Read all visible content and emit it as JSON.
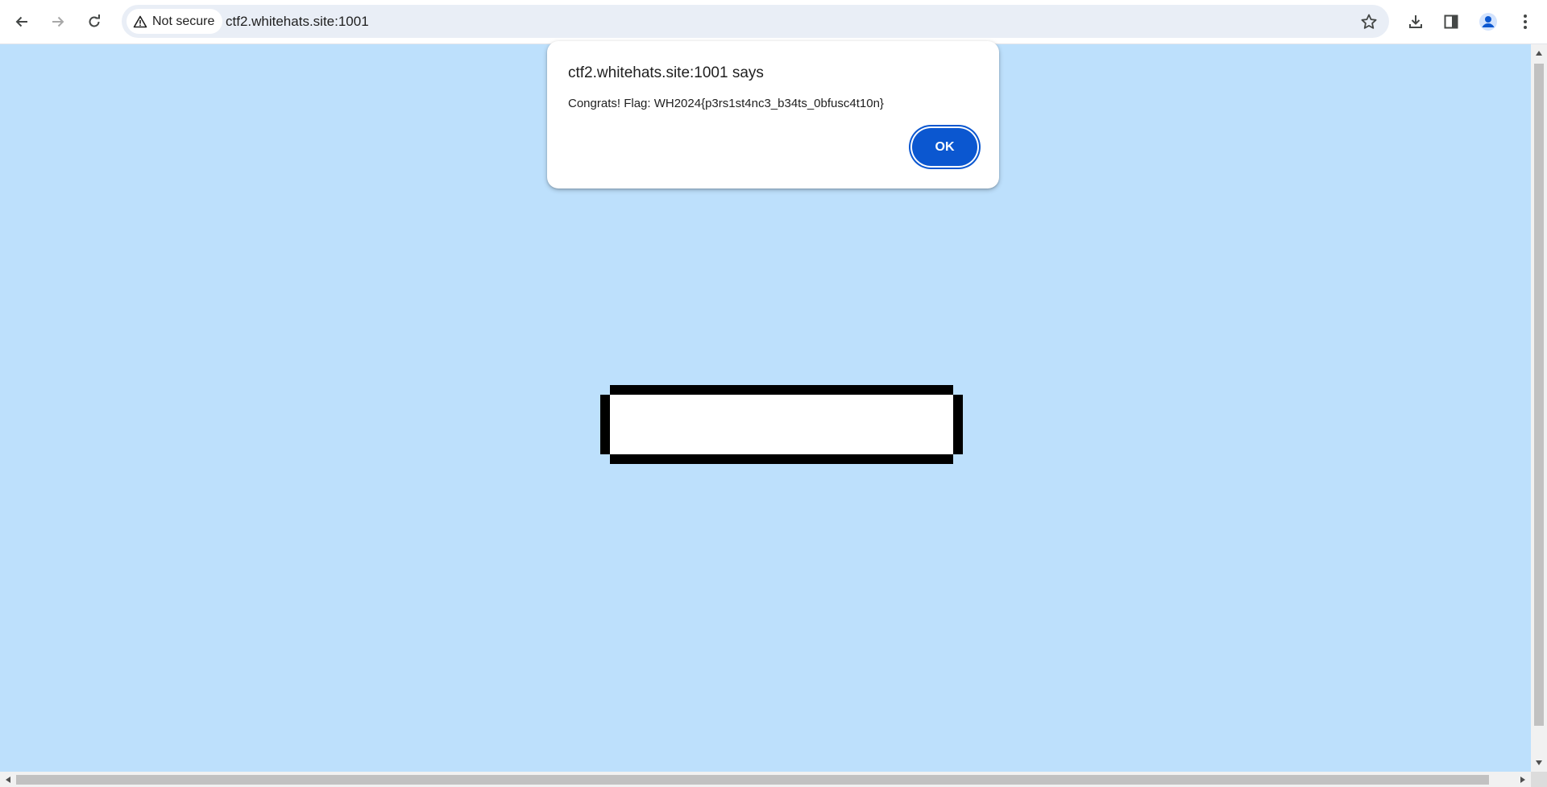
{
  "browser": {
    "security_chip": "Not secure",
    "url": "ctf2.whitehats.site:1001",
    "icons": {
      "back": "arrow-left-icon",
      "forward": "arrow-right-icon",
      "reload": "reload-icon",
      "warning": "warning-triangle-icon",
      "bookmark": "star-icon",
      "downloads": "download-icon",
      "side_panel": "side-panel-icon",
      "profile": "profile-avatar-icon",
      "menu": "kebab-menu-icon"
    },
    "colors": {
      "omnibox_bg": "#e9eef6",
      "profile_accent": "#0b57d0"
    }
  },
  "page": {
    "background": "#bde0fc"
  },
  "dialog": {
    "title": "ctf2.whitehats.site:1001 says",
    "message": "Congrats! Flag: WH2024{p3rs1st4nc3_b34ts_0bfusc4t10n}",
    "ok_label": "OK",
    "button_color": "#0b57d0"
  }
}
